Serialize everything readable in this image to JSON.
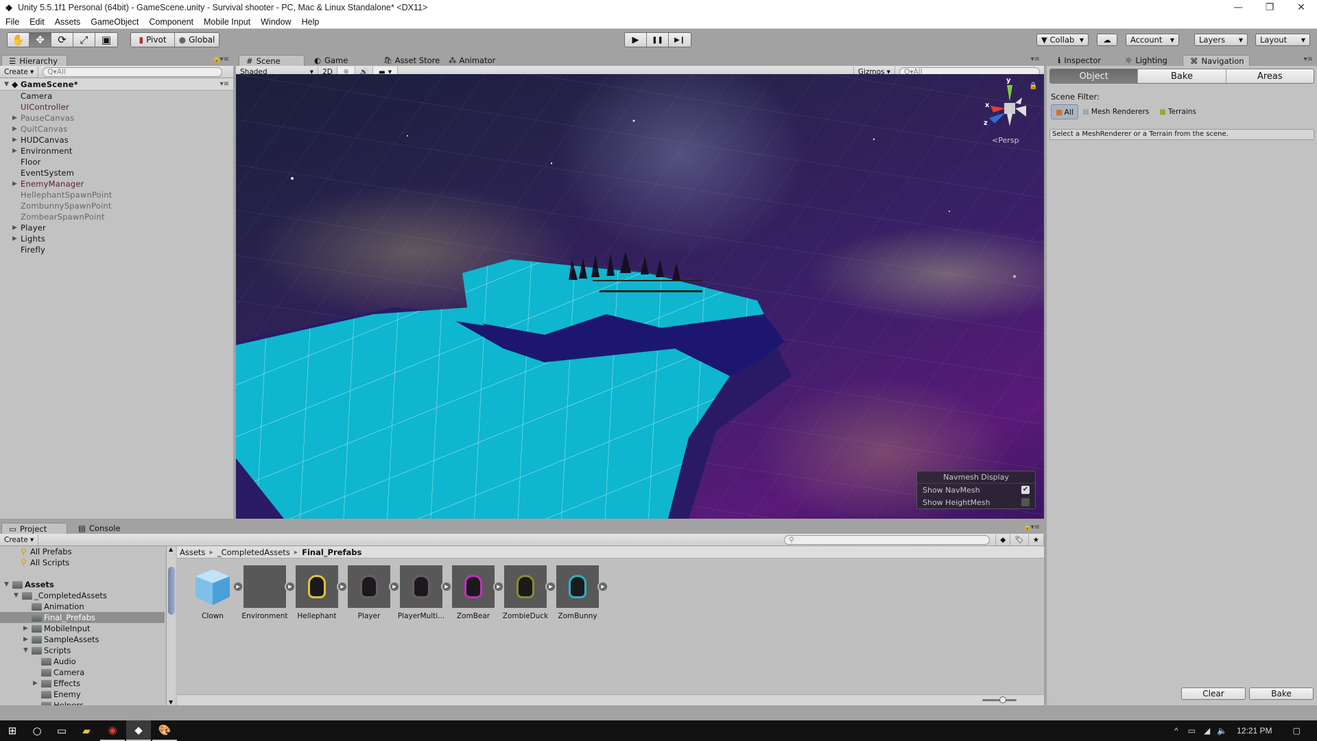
{
  "window": {
    "title": "Unity 5.5.1f1 Personal (64bit) - GameScene.unity - Survival shooter - PC, Mac & Linux Standalone* <DX11>",
    "controls": {
      "minimize": "—",
      "restore": "❐",
      "close": "✕"
    }
  },
  "menu": [
    "File",
    "Edit",
    "Assets",
    "GameObject",
    "Component",
    "Mobile Input",
    "Window",
    "Help"
  ],
  "toolbar": {
    "tools": [
      {
        "name": "hand-tool",
        "glyph": "✋"
      },
      {
        "name": "move-tool",
        "glyph": "✥",
        "active": true
      },
      {
        "name": "rotate-tool",
        "glyph": "⟳"
      },
      {
        "name": "scale-tool",
        "glyph": "⤢"
      },
      {
        "name": "rect-tool",
        "glyph": "▣"
      }
    ],
    "pivot_label": "Pivot",
    "global_label": "Global",
    "play": "▶",
    "pause": "❚❚",
    "step": "▶❙",
    "collab_label": "Collab",
    "cloud_glyph": "☁",
    "account_label": "Account",
    "layers_label": "Layers",
    "layout_label": "Layout"
  },
  "hierarchy": {
    "tab_label": "Hierarchy",
    "create_label": "Create",
    "search_placeholder": "All",
    "root": "GameScene*",
    "items": [
      {
        "label": "Camera",
        "expandable": false,
        "style": "normal"
      },
      {
        "label": "UIController",
        "expandable": false,
        "style": "prefab"
      },
      {
        "label": "PauseCanvas",
        "expandable": true,
        "style": "inactive"
      },
      {
        "label": "QuitCanvas",
        "expandable": true,
        "style": "inactive"
      },
      {
        "label": "HUDCanvas",
        "expandable": true,
        "style": "normal"
      },
      {
        "label": "Environment",
        "expandable": true,
        "style": "normal"
      },
      {
        "label": "Floor",
        "expandable": false,
        "style": "normal"
      },
      {
        "label": "EventSystem",
        "expandable": false,
        "style": "normal"
      },
      {
        "label": "EnemyManager",
        "expandable": true,
        "style": "prefab"
      },
      {
        "label": "HellephantSpawnPoint",
        "expandable": false,
        "style": "inactive"
      },
      {
        "label": "ZombunnySpawnPoint",
        "expandable": false,
        "style": "inactive"
      },
      {
        "label": "ZombearSpawnPoint",
        "expandable": false,
        "style": "inactive"
      },
      {
        "label": "Player",
        "expandable": true,
        "style": "normal"
      },
      {
        "label": "Lights",
        "expandable": true,
        "style": "normal"
      },
      {
        "label": "Firefly",
        "expandable": false,
        "style": "normal"
      }
    ]
  },
  "scene": {
    "tabs": [
      {
        "label": "Scene",
        "icon": "#",
        "active": true
      },
      {
        "label": "Game",
        "icon": "◐"
      },
      {
        "label": "Asset Store",
        "icon": "🛍"
      },
      {
        "label": "Animator",
        "icon": "⁂"
      }
    ],
    "shading_mode": "Shaded",
    "mode_2d": "2D",
    "gizmos_label": "Gizmos",
    "search_placeholder": "All",
    "projection_label": "Persp",
    "gizmo_axes": {
      "y": "y",
      "x": "x",
      "z": "z"
    },
    "navmesh_display": {
      "title": "Navmesh Display",
      "options": [
        {
          "label": "Show NavMesh",
          "checked": true
        },
        {
          "label": "Show HeightMesh",
          "checked": false
        }
      ]
    }
  },
  "inspector": {
    "tabs": [
      {
        "label": "Inspector",
        "icon": "ℹ"
      },
      {
        "label": "Lighting",
        "icon": "☼"
      },
      {
        "label": "Navigation",
        "icon": "⌘",
        "active": true
      }
    ],
    "segments": [
      {
        "label": "Object",
        "active": true
      },
      {
        "label": "Bake"
      },
      {
        "label": "Areas"
      }
    ],
    "scene_filter_label": "Scene Filter:",
    "filters": [
      {
        "label": "All",
        "active": true
      },
      {
        "label": "Mesh Renderers"
      },
      {
        "label": "Terrains"
      }
    ],
    "help_text": "Select a MeshRenderer or a Terrain from the scene.",
    "clear_label": "Clear",
    "bake_label": "Bake"
  },
  "project": {
    "tabs": [
      {
        "label": "Project",
        "active": true
      },
      {
        "label": "Console"
      }
    ],
    "create_label": "Create",
    "tree": [
      {
        "label": "All Prefabs",
        "level": 0,
        "type": "search"
      },
      {
        "label": "All Scripts",
        "level": 0,
        "type": "search"
      },
      {
        "label": "",
        "level": 0,
        "type": "spacer"
      },
      {
        "label": "Assets",
        "level": 0,
        "type": "folder",
        "expanded": true,
        "bold": true
      },
      {
        "label": "_CompletedAssets",
        "level": 1,
        "type": "folder",
        "expanded": true
      },
      {
        "label": "Animation",
        "level": 2,
        "type": "folder"
      },
      {
        "label": "Final_Prefabs",
        "level": 2,
        "type": "folder",
        "selected": true
      },
      {
        "label": "MobileInput",
        "level": 2,
        "type": "folder",
        "collapsed": true
      },
      {
        "label": "SampleAssets",
        "level": 2,
        "type": "folder",
        "collapsed": true
      },
      {
        "label": "Scripts",
        "level": 2,
        "type": "folder",
        "expanded": true
      },
      {
        "label": "Audio",
        "level": 3,
        "type": "folder"
      },
      {
        "label": "Camera",
        "level": 3,
        "type": "folder"
      },
      {
        "label": "Effects",
        "level": 3,
        "type": "folder",
        "collapsed": true
      },
      {
        "label": "Enemy",
        "level": 3,
        "type": "folder"
      },
      {
        "label": "Helpers",
        "level": 3,
        "type": "folder"
      }
    ],
    "breadcrumb": [
      "Assets",
      "_CompletedAssets",
      "Final_Prefabs"
    ],
    "assets": [
      {
        "label": "Clown",
        "kind": "cube",
        "color": "#6fb6e6"
      },
      {
        "label": "Environment",
        "kind": "empty",
        "color": "#585858"
      },
      {
        "label": "Hellephant",
        "kind": "creature",
        "color": "#e0c23a"
      },
      {
        "label": "Player",
        "kind": "creature",
        "color": "#6a5a6a"
      },
      {
        "label": "PlayerMulti...",
        "kind": "creature",
        "color": "#6a5a6a"
      },
      {
        "label": "ZomBear",
        "kind": "creature",
        "color": "#c030c0"
      },
      {
        "label": "ZombieDuck",
        "kind": "creature",
        "color": "#8a8a30"
      },
      {
        "label": "ZomBunny",
        "kind": "creature",
        "color": "#30b0c0"
      }
    ],
    "search_placeholder": "",
    "zoom_slider_value": 0.6
  },
  "taskbar": {
    "apps": [
      "start",
      "cortana",
      "task-view",
      "file-explorer",
      "chrome",
      "unity",
      "paint"
    ],
    "time": "12:21 PM"
  }
}
